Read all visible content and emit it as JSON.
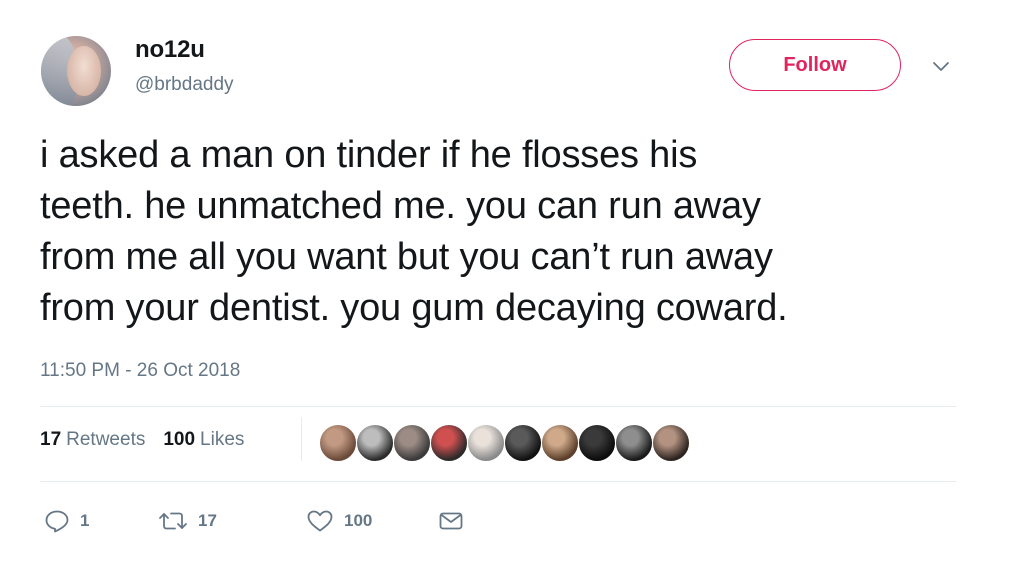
{
  "user": {
    "name": "no12u",
    "handle": "@brbdaddy"
  },
  "follow_button_label": "Follow",
  "tweet": {
    "text": "i asked a man on tinder if he flosses his\nteeth. he unmatched me. you can run away\nfrom me all you want but you can’t run away\nfrom your dentist. you gum decaying coward.",
    "timestamp": "11:50 PM - 26 Oct 2018"
  },
  "stats": {
    "retweets_count": "17",
    "retweets_label": "Retweets",
    "likes_count": "100",
    "likes_label": "Likes"
  },
  "liker_avatars": [
    {
      "name": "liker-avatar-1",
      "colors": [
        "#6b4a3a",
        "#c29a83"
      ]
    },
    {
      "name": "liker-avatar-2",
      "colors": [
        "#2b2b2b",
        "#bdbdbd"
      ]
    },
    {
      "name": "liker-avatar-3",
      "colors": [
        "#3a3a3a",
        "#9c8c85"
      ]
    },
    {
      "name": "liker-avatar-4",
      "colors": [
        "#2a2a2a",
        "#d05050"
      ]
    },
    {
      "name": "liker-avatar-5",
      "colors": [
        "#8a8a8a",
        "#e9e1da"
      ]
    },
    {
      "name": "liker-avatar-6",
      "colors": [
        "#111111",
        "#5a5a5a"
      ]
    },
    {
      "name": "liker-avatar-7",
      "colors": [
        "#5b3f2a",
        "#cfa98a"
      ]
    },
    {
      "name": "liker-avatar-8",
      "colors": [
        "#0c0c0c",
        "#3a3a3a"
      ]
    },
    {
      "name": "liker-avatar-9",
      "colors": [
        "#1a1a1a",
        "#8e8e8e"
      ]
    },
    {
      "name": "liker-avatar-10",
      "colors": [
        "#2c2420",
        "#b39281"
      ]
    }
  ],
  "actions": {
    "reply_count": "1",
    "retweet_count": "17",
    "like_count": "100"
  },
  "colors": {
    "follow_accent": "#e0245e",
    "secondary_text": "#657786",
    "primary_text": "#14171a",
    "divider": "#e6ecf0"
  },
  "icons": {
    "reply": "reply-icon",
    "retweet": "retweet-icon",
    "like": "heart-icon",
    "message": "envelope-icon",
    "caret": "chevron-down-icon"
  }
}
